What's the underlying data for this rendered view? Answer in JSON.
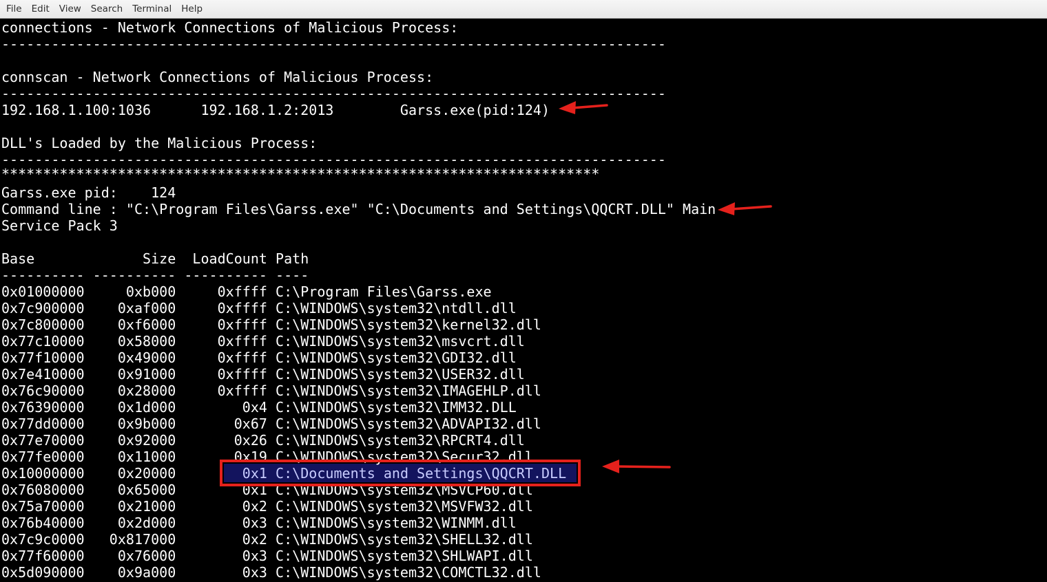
{
  "menubar": {
    "items": [
      "File",
      "Edit",
      "View",
      "Search",
      "Terminal",
      "Help"
    ]
  },
  "terminal": {
    "lines": [
      "connections - Network Connections of Malicious Process:",
      "--------------------------------------------------------------------------------",
      "",
      "connscan - Network Connections of Malicious Process:",
      "--------------------------------------------------------------------------------",
      "192.168.1.100:1036      192.168.1.2:2013        Garss.exe(pid:124)",
      "",
      "DLL's Loaded by the Malicious Process:",
      "--------------------------------------------------------------------------------",
      "************************************************************************",
      "Garss.exe pid:    124",
      "Command line : \"C:\\Program Files\\Garss.exe\" \"C:\\Documents and Settings\\QQCRT.DLL\" Main",
      "Service Pack 3",
      "",
      "Base             Size  LoadCount Path",
      "---------- ---------- ---------- ----",
      "0x01000000     0xb000     0xffff C:\\Program Files\\Garss.exe",
      "0x7c900000    0xaf000     0xffff C:\\WINDOWS\\system32\\ntdll.dll",
      "0x7c800000    0xf6000     0xffff C:\\WINDOWS\\system32\\kernel32.dll",
      "0x77c10000    0x58000     0xffff C:\\WINDOWS\\system32\\msvcrt.dll",
      "0x77f10000    0x49000     0xffff C:\\WINDOWS\\system32\\GDI32.dll",
      "0x7e410000    0x91000     0xffff C:\\WINDOWS\\system32\\USER32.dll",
      "0x76c90000    0x28000     0xffff C:\\WINDOWS\\system32\\IMAGEHLP.dll",
      "0x76390000    0x1d000        0x4 C:\\WINDOWS\\system32\\IMM32.DLL",
      "0x77dd0000    0x9b000       0x67 C:\\WINDOWS\\system32\\ADVAPI32.dll",
      "0x77e70000    0x92000       0x26 C:\\WINDOWS\\system32\\RPCRT4.dll",
      "0x77fe0000    0x11000       0x19 C:\\WINDOWS\\system32\\Secur32.dll",
      "0x10000000    0x20000        0x1 C:\\Documents and Settings\\QQCRT.DLL",
      "0x76080000    0x65000        0x1 C:\\WINDOWS\\system32\\MSVCP60.dll",
      "0x75a70000    0x21000        0x2 C:\\WINDOWS\\system32\\MSVFW32.dll",
      "0x76b40000    0x2d000        0x3 C:\\WINDOWS\\system32\\WINMM.dll",
      "0x7c9c0000   0x817000        0x2 C:\\WINDOWS\\system32\\SHELL32.dll",
      "0x77f60000    0x76000        0x3 C:\\WINDOWS\\system32\\SHLWAPI.dll",
      "0x5d090000    0x9a000        0x3 C:\\WINDOWS\\system32\\COMCTL32.dll"
    ],
    "highlight": {
      "prefix": "0x10000000    0x20000        ",
      "text": "0x1 C:\\Documents and Settings\\QQCRT.DLL"
    }
  },
  "colors": {
    "background": "#000000",
    "text": "#ffffff",
    "annotation": "#e5211c",
    "highlight_bg": "#13145e"
  }
}
